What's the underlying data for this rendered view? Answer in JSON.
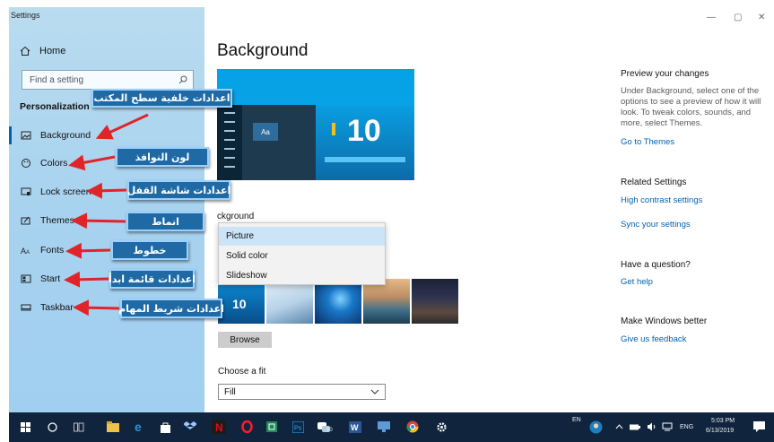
{
  "window": {
    "title": "Settings",
    "minimize_label": "—",
    "maximize_label": "▢",
    "close_label": "✕"
  },
  "sidebar": {
    "home_label": "Home",
    "search_placeholder": "Find a setting",
    "section_title": "Personalization",
    "items": [
      {
        "label": "Background",
        "icon": "image-icon",
        "selected": true
      },
      {
        "label": "Colors",
        "icon": "palette-icon"
      },
      {
        "label": "Lock screen",
        "icon": "lock-screen-icon"
      },
      {
        "label": "Themes",
        "icon": "brush-icon"
      },
      {
        "label": "Fonts",
        "icon": "font-icon"
      },
      {
        "label": "Start",
        "icon": "start-icon"
      },
      {
        "label": "Taskbar",
        "icon": "taskbar-icon"
      }
    ]
  },
  "annotations": [
    "اعدادات خلفية سطح المكتب",
    "لون النوافذ",
    "اعدادات شاشة القفل",
    "انماط",
    "خطوط",
    "اعدادات قائمة ابدأ",
    "اعدادات شريط المهام"
  ],
  "main": {
    "title": "Background",
    "preview_tile": "Aa",
    "preview_logo": "10",
    "background_label": "ckground",
    "background_options": [
      "Picture",
      "Solid color",
      "Slideshow"
    ],
    "selected_option": "Picture",
    "first_thumb_logo": "10",
    "browse_label": "Browse",
    "fit_label": "Choose a fit",
    "fit_value": "Fill"
  },
  "right_panel": {
    "preview_heading": "Preview your changes",
    "preview_text": "Under Background, select one of the options to see a preview of how it will look. To tweak colors, sounds, and more, select Themes.",
    "go_to_themes": "Go to Themes",
    "related_heading": "Related Settings",
    "high_contrast": "High contrast settings",
    "sync_settings": "Sync your settings",
    "question_heading": "Have a question?",
    "get_help": "Get help",
    "better_heading": "Make Windows better",
    "feedback": "Give us feedback"
  },
  "taskbar": {
    "lang_small": "EN",
    "lang": "ENG",
    "time": "5:03 PM",
    "date": "6/13/2019",
    "badge_count": "60"
  },
  "colors": {
    "accent": "#0063b1",
    "callout_bg": "#1f6aa5",
    "arrow": "#e0242a",
    "taskbar": "#10253d"
  }
}
